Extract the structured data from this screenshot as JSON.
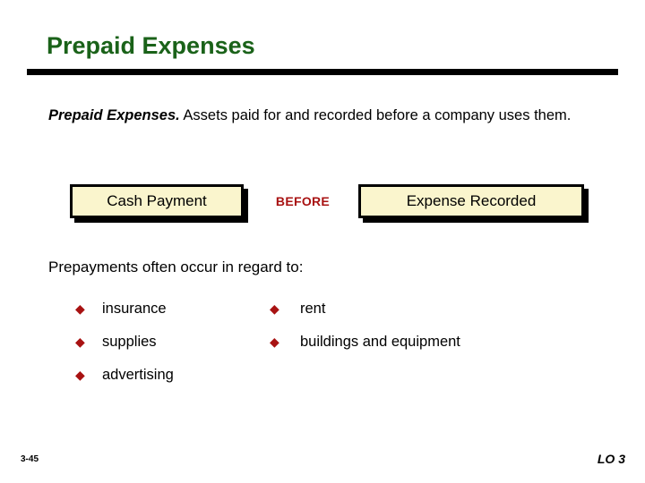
{
  "slide": {
    "title": "Prepaid Expenses",
    "title_color": "#1a6219",
    "accent_color": "#a81212",
    "box_fill_color": "#faf5cd"
  },
  "definition": {
    "term": "Prepaid Expenses.",
    "body": " Assets paid for and recorded before a company uses them."
  },
  "flow": {
    "left_box_label": "Cash Payment",
    "middle_label": "BEFORE",
    "right_box_label": "Expense Recorded"
  },
  "bullets": {
    "lead_in": "Prepayments often occur in regard to:",
    "marker": "◆",
    "left_column": [
      {
        "label": "insurance"
      },
      {
        "label": "supplies"
      },
      {
        "label": "advertising"
      }
    ],
    "right_column": [
      {
        "label": "rent"
      },
      {
        "label": "buildings and equipment"
      }
    ]
  },
  "footer": {
    "page_number": "3-45",
    "learning_objective": "LO 3"
  }
}
